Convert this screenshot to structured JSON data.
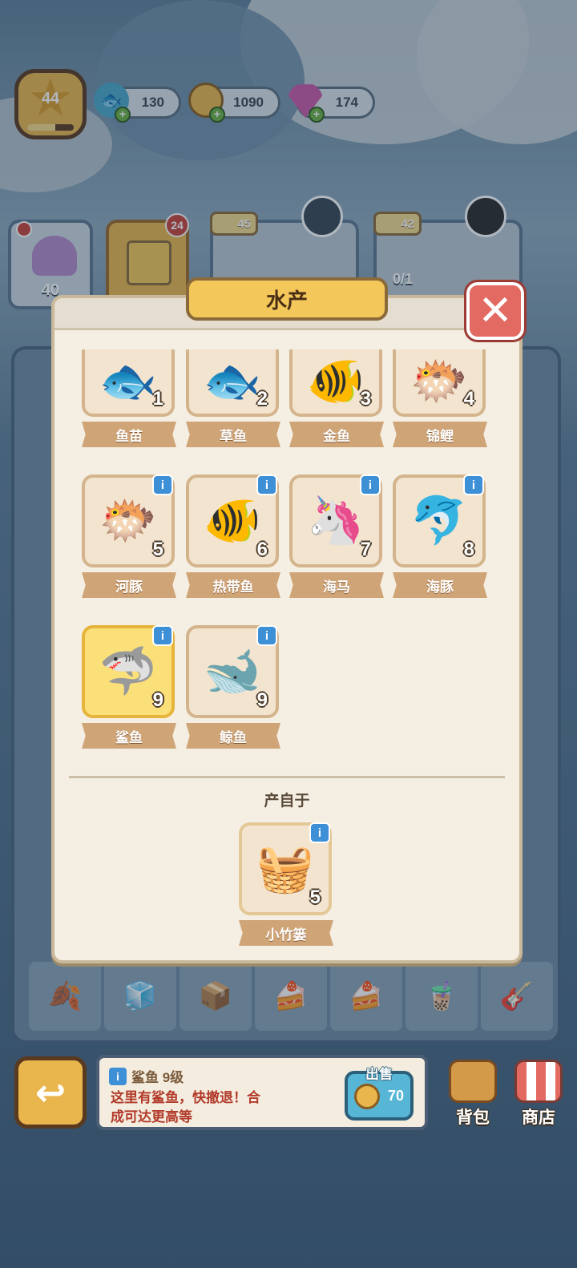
{
  "player": {
    "level": "44",
    "level_progress": 0.6
  },
  "resources": [
    {
      "name": "energy",
      "icon": "energy-fish-icon",
      "value": "130"
    },
    {
      "name": "coins",
      "icon": "coin-icon",
      "value": "1090"
    },
    {
      "name": "gems",
      "icon": "gem-icon",
      "value": "174"
    }
  ],
  "orders": {
    "shell_count": "40",
    "gift_badge": "24",
    "order1_reward": "45",
    "order2_reward": "42",
    "order2_progress": "0/1"
  },
  "modal": {
    "title": "水产",
    "chain": [
      {
        "name": "鱼苗",
        "level": "1",
        "icon": "fry-fish-icon",
        "info": false
      },
      {
        "name": "草鱼",
        "level": "2",
        "icon": "grass-carp-icon",
        "info": false
      },
      {
        "name": "金鱼",
        "level": "3",
        "icon": "goldfish-icon",
        "info": false
      },
      {
        "name": "锦鲤",
        "level": "4",
        "icon": "koi-icon",
        "info": false
      },
      {
        "name": "河豚",
        "level": "5",
        "icon": "pufferfish-icon",
        "info": true
      },
      {
        "name": "热带鱼",
        "level": "6",
        "icon": "tropical-fish-icon",
        "info": true
      },
      {
        "name": "海马",
        "level": "7",
        "icon": "seahorse-icon",
        "info": true
      },
      {
        "name": "海豚",
        "level": "8",
        "icon": "dolphin-icon",
        "info": true
      },
      {
        "name": "鲨鱼",
        "level": "9",
        "icon": "shark-icon",
        "info": true,
        "selected": true
      },
      {
        "name": "鲸鱼",
        "level": "9",
        "icon": "whale-icon",
        "info": true
      }
    ],
    "source_label": "产自于",
    "source": {
      "name": "小竹篓",
      "level": "5",
      "icon": "bamboo-basket-icon",
      "info": true
    }
  },
  "info_panel": {
    "title": "鲨鱼  9级",
    "description": "这里有鲨鱼，快撤退！合成可达更高等",
    "sell_label": "出售",
    "sell_price": "70"
  },
  "nav": {
    "backpack": "背包",
    "shop": "商店"
  },
  "colors": {
    "accent": "#f3c75a",
    "close": "#e36a63",
    "info": "#3d8fd6"
  }
}
